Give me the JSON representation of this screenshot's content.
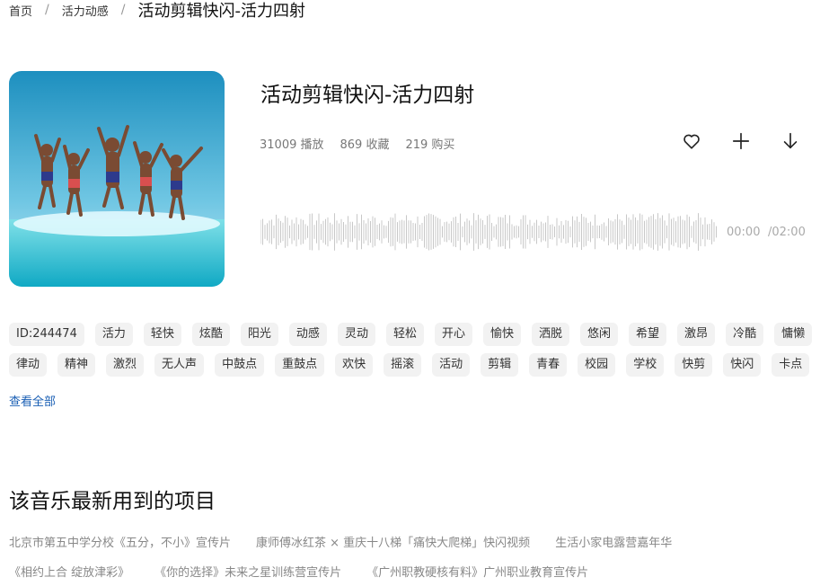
{
  "breadcrumb": {
    "home": "首页",
    "category": "活力动感",
    "current": "活动剪辑快闪-活力四射"
  },
  "track": {
    "title": "活动剪辑快闪-活力四射",
    "plays": "31009 播放",
    "favorites": "869 收藏",
    "purchases": "219 购买",
    "current_time": "00:00",
    "total_time": "/02:00"
  },
  "actions": {
    "like_icon": "heart-icon",
    "add_icon": "plus-icon",
    "download_icon": "download-arrow-icon"
  },
  "tags": [
    "ID:244474",
    "活力",
    "轻快",
    "炫酷",
    "阳光",
    "动感",
    "灵动",
    "轻松",
    "开心",
    "愉快",
    "洒脱",
    "悠闲",
    "希望",
    "激昂",
    "冷酷",
    "慵懒",
    "律动",
    "精神",
    "激烈",
    "无人声",
    "中鼓点",
    "重鼓点",
    "欢快",
    "摇滚",
    "活动",
    "剪辑",
    "青春",
    "校园",
    "学校",
    "快剪",
    "快闪",
    "卡点"
  ],
  "view_all": "查看全部",
  "projects_section": {
    "title": "该音乐最新用到的项目",
    "items": [
      "北京市第五中学分校《五分，不小》宣传片",
      "康师傅冰红茶 × 重庆十八梯「痛快大爬梯」快闪视频",
      "生活小家电露营嘉年华",
      "《相约上合 绽放津彩》",
      "《你的选择》未来之星训练营宣传片",
      "《广州职教硬核有料》广州职业教育宣传片"
    ]
  },
  "colors": {
    "link": "#1a5fb4",
    "tag_bg": "#f2f2f2",
    "waveform": "#c8c8c8"
  }
}
